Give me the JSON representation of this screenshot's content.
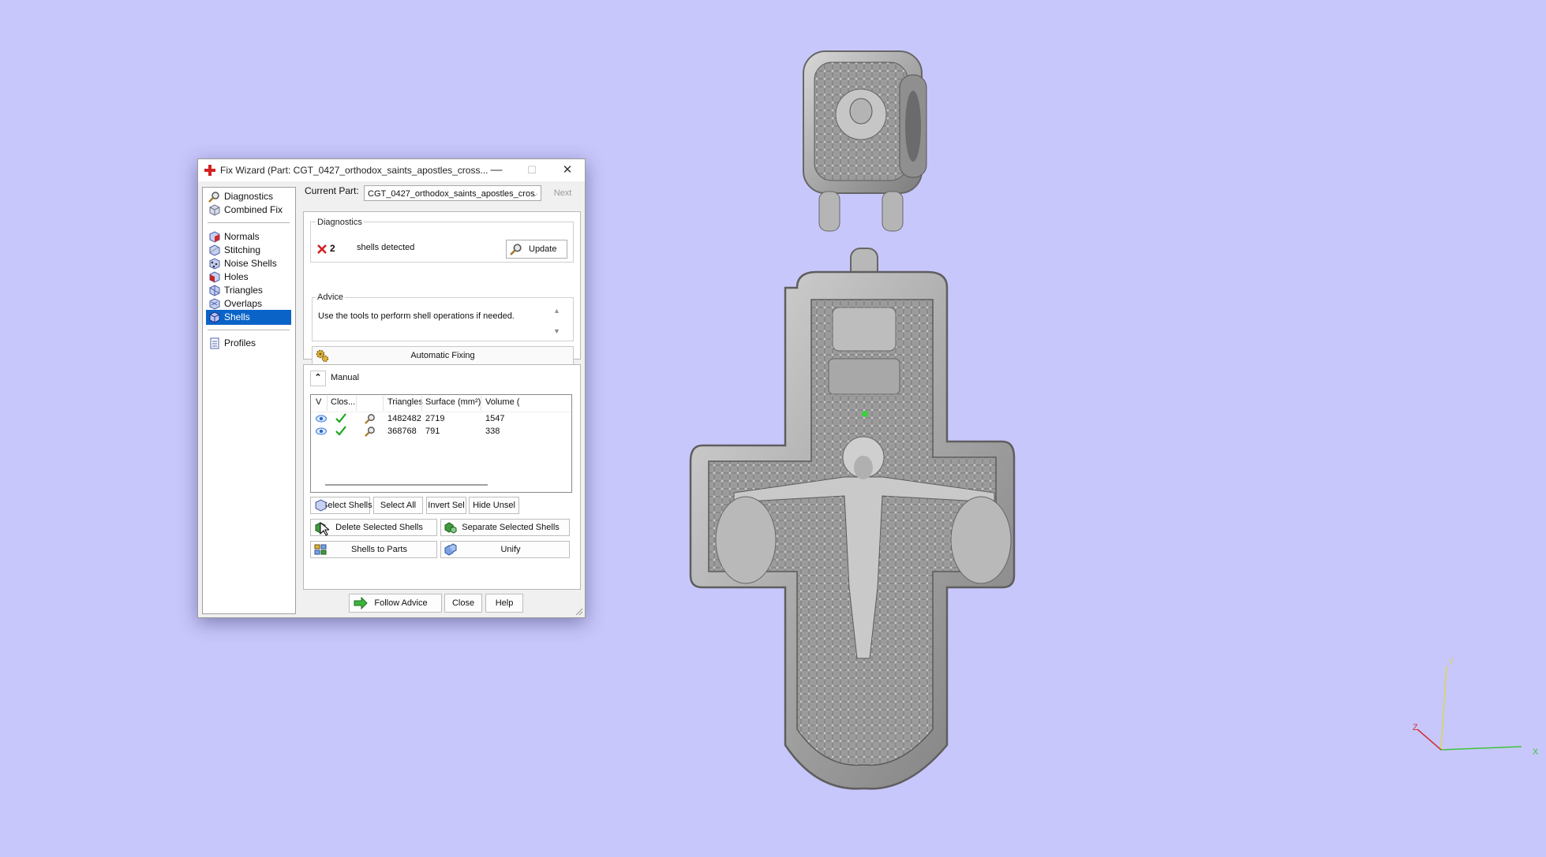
{
  "window": {
    "title": "Fix Wizard (Part: CGT_0427_orthodox_saints_apostles_cross...",
    "controls": {
      "minimize": "—",
      "maximize": "☐",
      "close": "✕"
    }
  },
  "nav": {
    "items": [
      {
        "label": "Diagnostics",
        "icon": "magnifier-icon"
      },
      {
        "label": "Combined Fix",
        "icon": "cube-icon"
      },
      {
        "label": "Normals",
        "icon": "normals-cube-icon"
      },
      {
        "label": "Stitching",
        "icon": "stitching-cube-icon"
      },
      {
        "label": "Noise Shells",
        "icon": "noise-shells-icon"
      },
      {
        "label": "Holes",
        "icon": "holes-cube-icon"
      },
      {
        "label": "Triangles",
        "icon": "triangles-cube-icon"
      },
      {
        "label": "Overlaps",
        "icon": "overlaps-cube-icon"
      },
      {
        "label": "Shells",
        "icon": "shells-cube-icon",
        "selected": true
      },
      {
        "label": "Profiles",
        "icon": "document-icon"
      }
    ]
  },
  "current_part": {
    "label": "Current Part:",
    "value": "CGT_0427_orthodox_saints_apostles_cros",
    "next_label": "Next"
  },
  "diagnostics": {
    "title": "Diagnostics",
    "count": "2",
    "message": "shells detected",
    "update_label": "Update",
    "status_color": "#d42020"
  },
  "advice": {
    "title": "Advice",
    "text": "Use the tools to perform shell operations if needed."
  },
  "auto_fix_label": "Automatic Fixing",
  "manual": {
    "title": "Manual",
    "columns": [
      "V",
      "Clos...",
      "",
      "Triangles",
      "Surface (mm²)",
      "Volume ("
    ],
    "rows": [
      {
        "triangles": "1482482",
        "surface": "2719",
        "volume": "1547"
      },
      {
        "triangles": "368768",
        "surface": "791",
        "volume": "338"
      }
    ],
    "buttons": {
      "select_shells": "Select Shells",
      "select_all": "Select All",
      "invert_sel": "Invert Sel",
      "hide_unsel": "Hide Unsel",
      "delete_selected": "Delete Selected Shells",
      "separate_selected": "Separate Selected Shells",
      "shells_to_parts": "Shells to Parts",
      "unify": "Unify"
    }
  },
  "footer": {
    "follow_advice": "Follow Advice",
    "close": "Close",
    "help": "Help"
  },
  "viewport": {
    "background": "#c8c7fb",
    "axes": {
      "x": "X",
      "y": "Y",
      "z": "Z"
    }
  },
  "colors": {
    "selection": "#0a64c8",
    "check": "#1aa51a",
    "accent_red": "#d42020"
  }
}
